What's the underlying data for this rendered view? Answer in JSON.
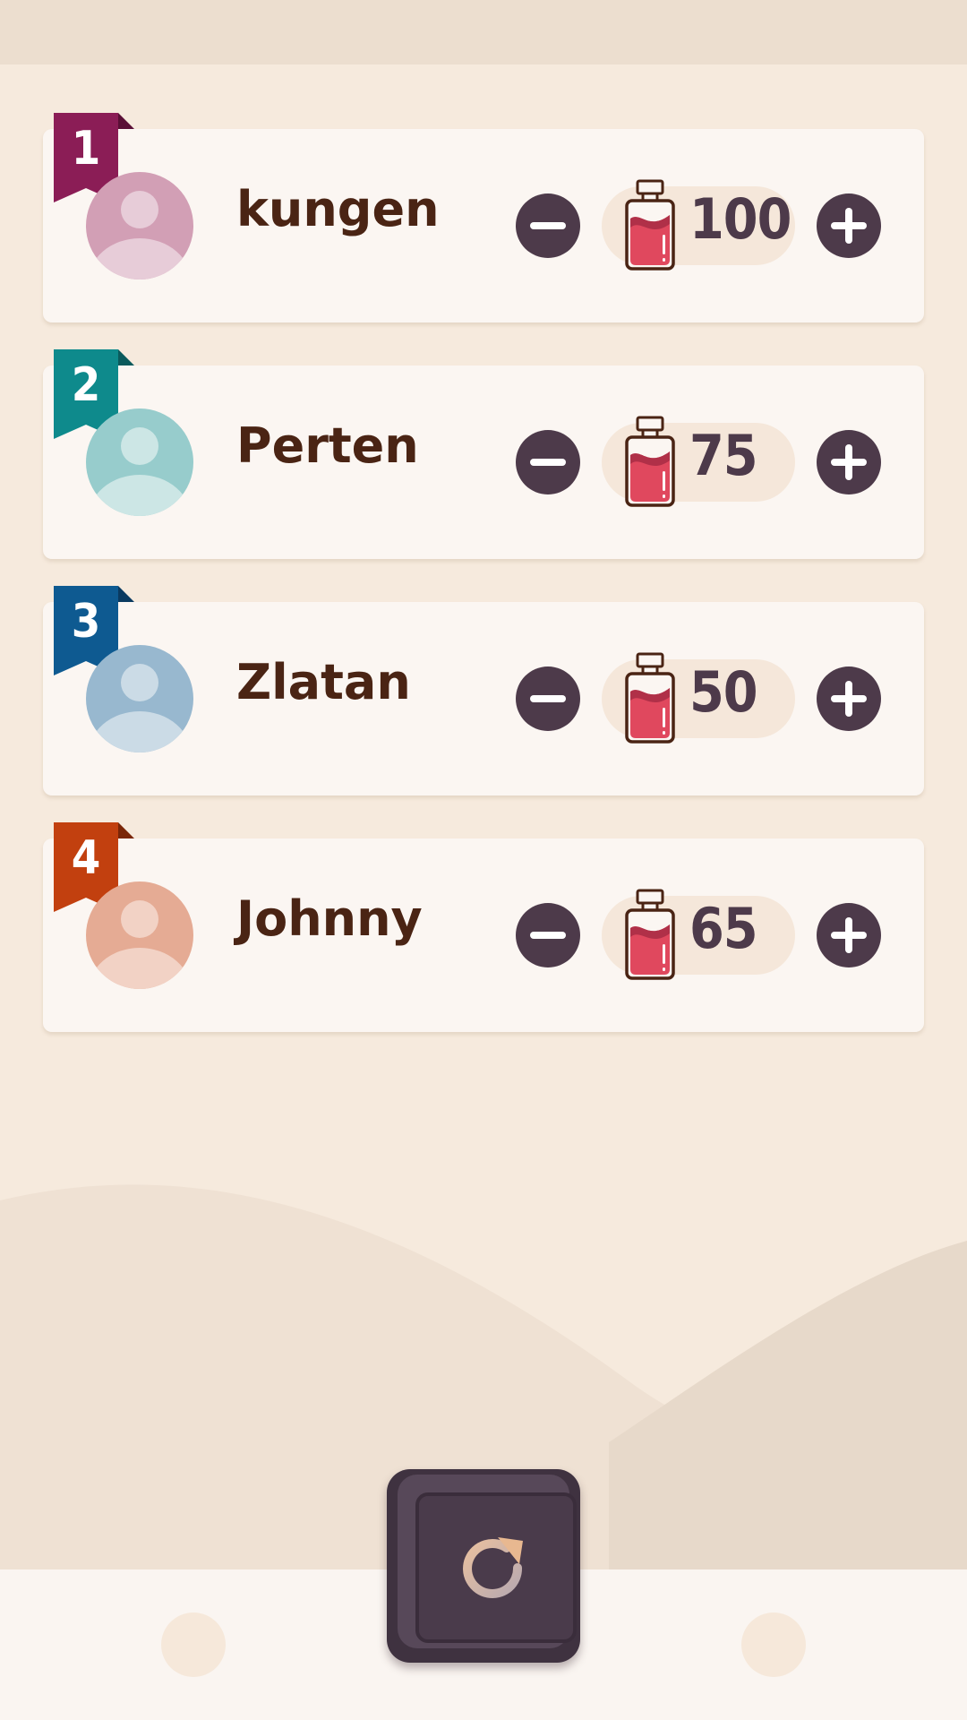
{
  "players": [
    {
      "rank": "1",
      "name": "kungen",
      "score": "100",
      "badge_color": "#8b1d56",
      "badge_dark": "#5a0f36",
      "avatar_bg": "#d29fb5",
      "avatar_fg": "#e7ccd8"
    },
    {
      "rank": "2",
      "name": "Perten",
      "score": "75",
      "badge_color": "#0e8a8c",
      "badge_dark": "#0a5a5c",
      "avatar_bg": "#97cccc",
      "avatar_fg": "#cce6e5"
    },
    {
      "rank": "3",
      "name": "Zlatan",
      "score": "50",
      "badge_color": "#0e5a91",
      "badge_dark": "#0a3a60",
      "avatar_bg": "#98b8cf",
      "avatar_fg": "#cbdbe6"
    },
    {
      "rank": "4",
      "name": "Johnny",
      "score": "65",
      "badge_color": "#c2400f",
      "badge_dark": "#7a2608",
      "avatar_bg": "#e5ab94",
      "avatar_fg": "#f2d2c5"
    }
  ],
  "icons": {
    "decrement": "minus-icon",
    "increment": "plus-icon",
    "score": "potion-bottle-icon",
    "reset": "refresh-icon"
  },
  "colors": {
    "button_dark": "#4d3a4a",
    "potion_red": "#e0485e",
    "background": "#f6eadd"
  }
}
